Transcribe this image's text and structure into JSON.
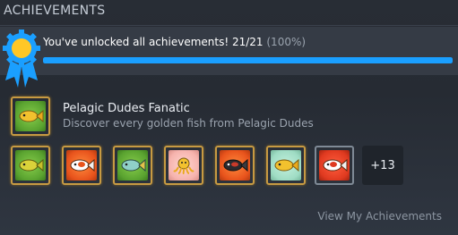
{
  "section": {
    "title": "ACHIEVEMENTS"
  },
  "summary": {
    "message": "You've unlocked all achievements! 21/21",
    "percent_label": "(100%)",
    "progress_fraction": 1.0,
    "accent": "#1a9fff"
  },
  "featured": {
    "name": "Pelagic Dudes Fanatic",
    "description": "Discover every golden fish from Pelagic Dudes",
    "icon": "golden-fish-icon"
  },
  "icons": [
    {
      "bg": "green",
      "fish": "golden-fish-icon"
    },
    {
      "bg": "orange",
      "fish": "koi-fish-icon"
    },
    {
      "bg": "green",
      "fish": "teal-fish-icon"
    },
    {
      "bg": "pink",
      "fish": "octopus-icon"
    },
    {
      "bg": "orange",
      "fish": "dark-fish-icon"
    },
    {
      "bg": "mint",
      "fish": "golden-fish-icon"
    },
    {
      "bg": "red",
      "fish": "koi-fish-icon"
    }
  ],
  "more_label": "+13",
  "footer": {
    "link_label": "View My Achievements"
  }
}
